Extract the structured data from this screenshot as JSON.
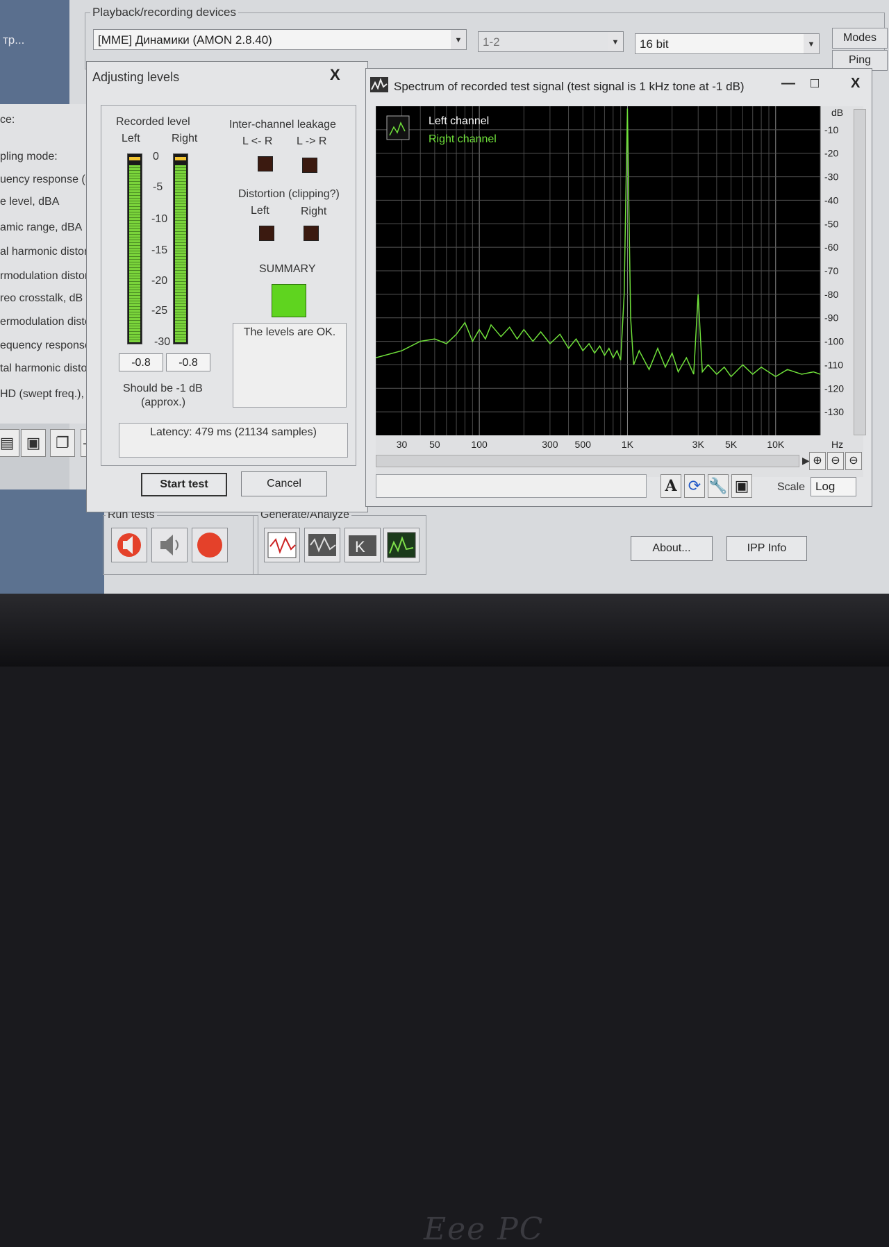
{
  "desktop": {
    "label": "тр..."
  },
  "playback": {
    "group_title": "Playback/recording devices",
    "device": "[MME] Динамики (AMON 2.8.40)",
    "channels": "1-2",
    "bits": "16 bit",
    "modes_button": "Modes",
    "ping_button": "Ping"
  },
  "left_list": [
    "ce:",
    "pling mode:",
    "uency response (r",
    "e level, dBA",
    "amic range, dBA",
    "al harmonic distortic",
    "rmodulation distorti",
    "reo crosstalk, dB",
    "ermodulation distorti",
    "equency response (s",
    "tal harmonic distortic",
    "HD (swept freq.), %"
  ],
  "levels_dialog": {
    "title": "Adjusting levels",
    "close": "X",
    "recorded_level": "Recorded level",
    "left": "Left",
    "right": "Right",
    "scale": [
      "0",
      "-5",
      "-10",
      "-15",
      "-20",
      "-25",
      "-30"
    ],
    "left_value": "-0.8",
    "right_value": "-0.8",
    "left_level_db": -0.8,
    "right_level_db": -0.8,
    "should_be": "Should be  -1 dB",
    "approx": "(approx.)",
    "leakage_title": "Inter-channel leakage",
    "leak_l": "L <- R",
    "leak_r": "L -> R",
    "distortion_title": "Distortion (clipping?)",
    "dist_left": "Left",
    "dist_right": "Right",
    "summary": "SUMMARY",
    "summary_color": "#5fd41f",
    "message": "The levels are OK.",
    "latency": "Latency: 479 ms (21134 samples)",
    "start_button": "Start test",
    "cancel_button": "Cancel"
  },
  "spectrum": {
    "title": "Spectrum of recorded test signal (test signal is 1 kHz tone at -1 dB)",
    "minimize": "—",
    "maximize": "□",
    "close": "X",
    "scale_label": "Scale",
    "scale_value": "Log"
  },
  "chart_data": {
    "type": "line",
    "xlabel": "Hz",
    "ylabel": "dB",
    "x_scale": "log",
    "xlim": [
      20,
      20000
    ],
    "ylim": [
      -140,
      0
    ],
    "grid": true,
    "x_ticks": [
      "30",
      "50",
      "100",
      "300",
      "500",
      "1K",
      "3K",
      "5K",
      "10K"
    ],
    "x_tick_values": [
      30,
      50,
      100,
      300,
      500,
      1000,
      3000,
      5000,
      10000
    ],
    "y_ticks": [
      "-10",
      "-20",
      "-30",
      "-40",
      "-50",
      "-60",
      "-70",
      "-80",
      "-90",
      "-100",
      "-110",
      "-120",
      "-130"
    ],
    "y_tick_values": [
      -10,
      -20,
      -30,
      -40,
      -50,
      -60,
      -70,
      -80,
      -90,
      -100,
      -110,
      -120,
      -130
    ],
    "legend_placement": "top-left",
    "series": [
      {
        "name": "Left channel",
        "color": "#ffffff",
        "x": [],
        "values": []
      },
      {
        "name": "Right channel",
        "color": "#6fe03a",
        "x": [
          20,
          30,
          40,
          50,
          60,
          70,
          80,
          90,
          100,
          110,
          120,
          140,
          160,
          180,
          200,
          230,
          260,
          300,
          350,
          400,
          450,
          500,
          550,
          600,
          650,
          700,
          750,
          800,
          850,
          900,
          950,
          980,
          1000,
          1020,
          1050,
          1100,
          1200,
          1400,
          1600,
          1800,
          2000,
          2200,
          2500,
          2800,
          3000,
          3200,
          3500,
          4000,
          4500,
          5000,
          6000,
          7000,
          8000,
          10000,
          12000,
          15000,
          18000,
          20000
        ],
        "values": [
          -107,
          -104,
          -100,
          -99,
          -101,
          -97,
          -92,
          -100,
          -95,
          -99,
          -93,
          -98,
          -94,
          -99,
          -95,
          -100,
          -96,
          -101,
          -97,
          -103,
          -99,
          -104,
          -101,
          -105,
          -102,
          -106,
          -103,
          -107,
          -104,
          -108,
          -80,
          -30,
          -1,
          -40,
          -90,
          -110,
          -104,
          -112,
          -103,
          -111,
          -105,
          -113,
          -107,
          -114,
          -80,
          -113,
          -110,
          -114,
          -111,
          -115,
          -110,
          -114,
          -111,
          -115,
          -112,
          -114,
          -113,
          -114
        ]
      }
    ]
  },
  "run_tests": {
    "title": "Run tests"
  },
  "generate": {
    "title": "Generate/Analyze"
  },
  "buttons": {
    "about": "About...",
    "ipp": "IPP Info"
  }
}
